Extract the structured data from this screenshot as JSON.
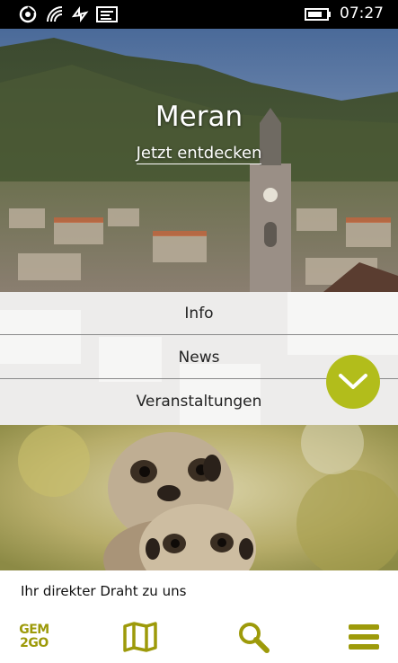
{
  "status_bar": {
    "time": "07:27",
    "icons": [
      "sync-icon",
      "wifi-icon",
      "nfc-icon",
      "message-icon",
      "battery-icon"
    ]
  },
  "hero": {
    "title": "Meran",
    "link": "Jetzt entdecken"
  },
  "menu": {
    "items": [
      "Info",
      "News",
      "Veranstaltungen"
    ],
    "expand_icon": "chevron-down-icon"
  },
  "contact": {
    "label": "Ihr direkter Draht zu uns"
  },
  "app_bar": {
    "logo_line1": "GEM",
    "logo_line2": "2GO",
    "buttons": [
      "gem2go-logo",
      "map-icon",
      "search-icon",
      "menu-icon"
    ]
  },
  "colors": {
    "accent": "#b2bd1b",
    "app_bar_icon": "#9d9a0a",
    "status_bar_bg": "#000000"
  }
}
